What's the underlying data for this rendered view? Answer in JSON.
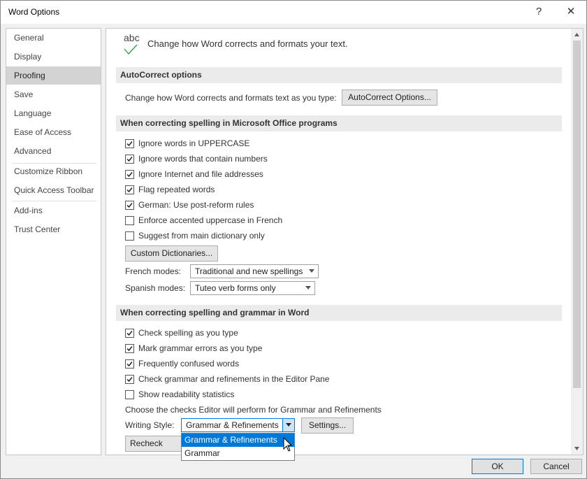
{
  "window": {
    "title": "Word Options",
    "help_label": "?",
    "close_label": "✕"
  },
  "nav": {
    "items": [
      "General",
      "Display",
      "Proofing",
      "Save",
      "Language",
      "Ease of Access",
      "Advanced",
      "Customize Ribbon",
      "Quick Access Toolbar",
      "Add-ins",
      "Trust Center"
    ],
    "selected": "Proofing"
  },
  "header": {
    "icon_text": "abc",
    "text": "Change how Word corrects and formats your text."
  },
  "autocorrect": {
    "section": "AutoCorrect options",
    "text": "Change how Word corrects and formats text as you type:",
    "button": "AutoCorrect Options..."
  },
  "office_spelling": {
    "section": "When correcting spelling in Microsoft Office programs",
    "checks": [
      {
        "label": "Ignore words in UPPERCASE",
        "checked": true
      },
      {
        "label": "Ignore words that contain numbers",
        "checked": true
      },
      {
        "label": "Ignore Internet and file addresses",
        "checked": true
      },
      {
        "label": "Flag repeated words",
        "checked": true
      },
      {
        "label": "German: Use post-reform rules",
        "checked": true
      },
      {
        "label": "Enforce accented uppercase in French",
        "checked": false
      },
      {
        "label": "Suggest from main dictionary only",
        "checked": false
      }
    ],
    "custom_dict_button": "Custom Dictionaries...",
    "french_label": "French modes:",
    "french_value": "Traditional and new spellings",
    "spanish_label": "Spanish modes:",
    "spanish_value": "Tuteo verb forms only"
  },
  "word_spelling": {
    "section": "When correcting spelling and grammar in Word",
    "checks": [
      {
        "label": "Check spelling as you type",
        "checked": true
      },
      {
        "label": "Mark grammar errors as you type",
        "checked": true
      },
      {
        "label": "Frequently confused words",
        "checked": true
      },
      {
        "label": "Check grammar and refinements in the Editor Pane",
        "checked": true
      },
      {
        "label": "Show readability statistics",
        "checked": false
      }
    ],
    "choose_text": "Choose the checks Editor will perform for Grammar and Refinements",
    "writing_style_label": "Writing Style:",
    "writing_style_value": "Grammar & Refinements",
    "settings_button": "Settings...",
    "recheck_button": "Recheck Docu"
  },
  "dropdown": {
    "options": [
      "Grammar & Refinements",
      "Grammar"
    ],
    "highlighted": "Grammar & Refinements"
  },
  "footer": {
    "ok": "OK",
    "cancel": "Cancel"
  },
  "colors": {
    "accent": "#0078d7",
    "check_green": "#2e9a4a",
    "selected_nav": "#d3d3d3"
  }
}
